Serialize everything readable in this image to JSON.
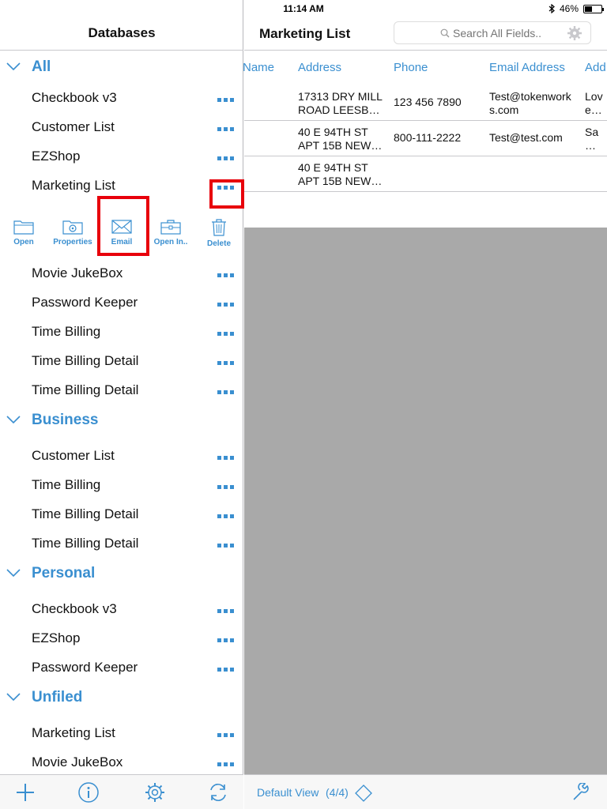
{
  "status_bar": {
    "device": "iPad",
    "time": "11:14 AM",
    "battery": "46%",
    "battery_level": 0.46
  },
  "left": {
    "title": "Databases",
    "sections": [
      {
        "name": "All",
        "items": [
          "Checkbook v3",
          "Customer List",
          "EZShop",
          "Marketing List",
          "Movie JukeBox",
          "Password Keeper",
          "Time Billing",
          "Time Billing Detail",
          "Time Billing Detail"
        ]
      },
      {
        "name": "Business",
        "items": [
          "Customer List",
          "Time Billing",
          "Time Billing Detail",
          "Time Billing Detail"
        ]
      },
      {
        "name": "Personal",
        "items": [
          "Checkbook v3",
          "EZShop",
          "Password Keeper"
        ]
      },
      {
        "name": "Unfiled",
        "items": [
          "Marketing List",
          "Movie JukeBox"
        ]
      }
    ],
    "actions": [
      {
        "label": "Open",
        "icon": "folder-icon"
      },
      {
        "label": "Properties",
        "icon": "properties-icon"
      },
      {
        "label": "Email",
        "icon": "envelope-icon"
      },
      {
        "label": "Open In..",
        "icon": "briefcase-icon"
      },
      {
        "label": "Delete",
        "icon": "trash-icon"
      }
    ],
    "toolbar": [
      "plus-icon",
      "info-icon",
      "gear-icon",
      "sync-icon"
    ]
  },
  "right": {
    "title": "Marketing List",
    "search_placeholder": "Search All Fields..",
    "columns": [
      "Name",
      "Address",
      "Phone",
      "Email Address",
      "Add"
    ],
    "rows": [
      {
        "name": "",
        "address": "17313 DRY MILL\nROAD LEESB…",
        "phone": "123 456 7890",
        "email": "Test@tokenwork\ns.com",
        "extra": "Lov\ne…"
      },
      {
        "name": "",
        "address": "40 E 94TH ST\nAPT 15B NEW…",
        "phone": "800-111-2222",
        "email": "Test@test.com",
        "extra": "Sa\n…"
      },
      {
        "name": "",
        "address": "40 E 94TH ST\nAPT 15B NEW…",
        "phone": "",
        "email": "",
        "extra": ""
      }
    ],
    "footer": {
      "view": "Default View",
      "count": "(4/4)"
    }
  },
  "colors": {
    "accent": "#3a8fd0",
    "highlight": "#e8000b",
    "empty_area": "#a9a9a9"
  }
}
